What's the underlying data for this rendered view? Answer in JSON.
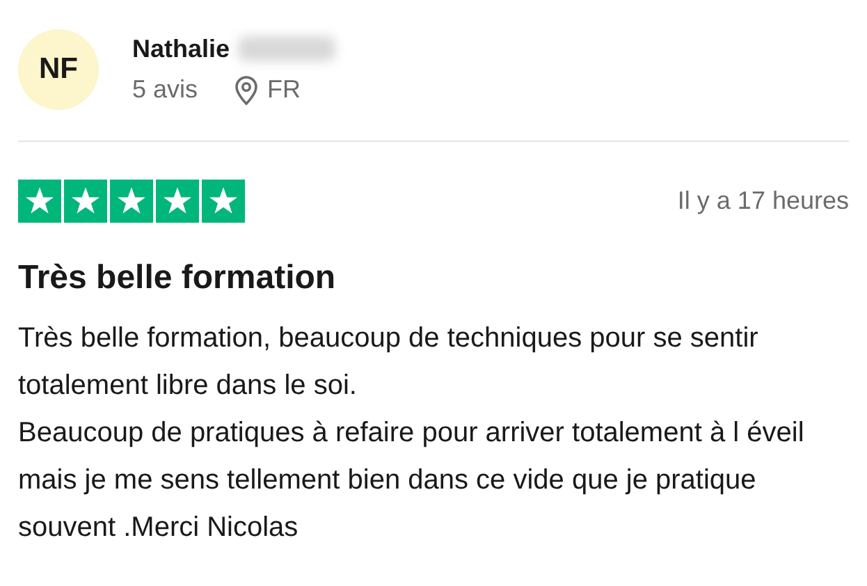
{
  "reviewer": {
    "initials": "NF",
    "name": "Nathalie",
    "review_count": "5 avis",
    "country": "FR"
  },
  "review": {
    "stars": 5,
    "time": "Il y a 17 heures",
    "title": "Très belle formation",
    "body": "Très belle formation, beaucoup de techniques pour se sentir totalement libre dans le soi.\nBeaucoup de pratiques à refaire pour arriver totalement à l éveil mais je me sens tellement bien dans ce vide que je pratique souvent .Merci Nicolas"
  }
}
